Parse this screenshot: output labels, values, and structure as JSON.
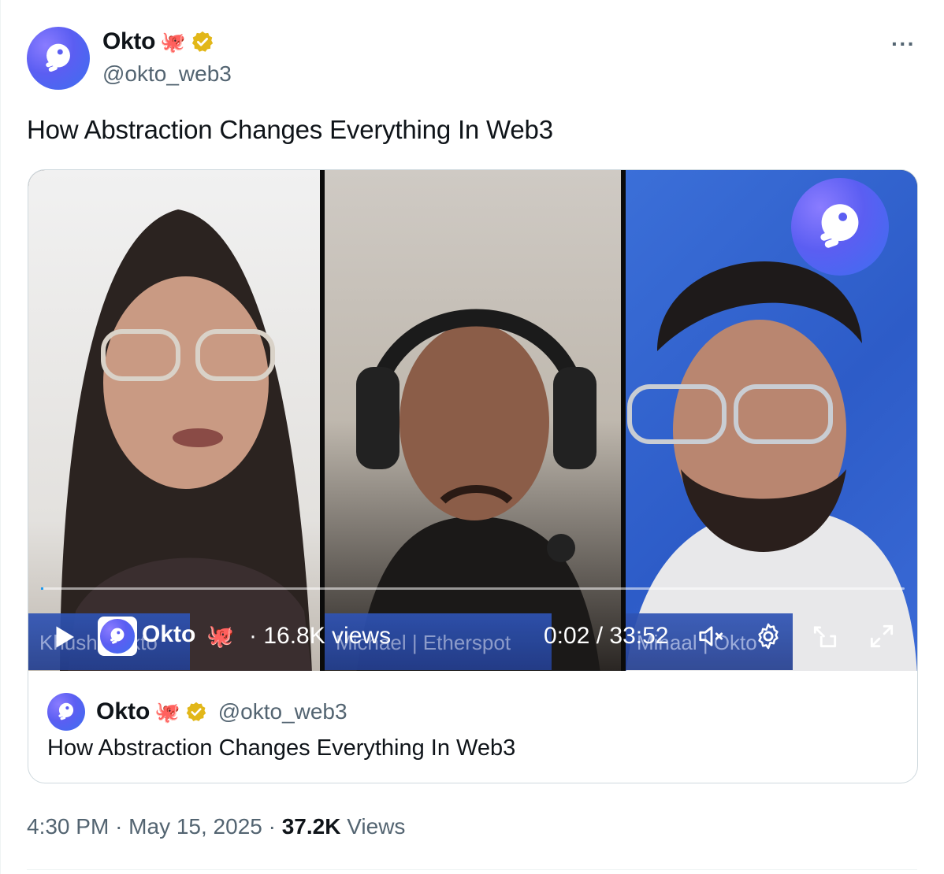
{
  "author": {
    "display_name": "Okto",
    "emoji": "🐙",
    "handle": "@okto_web3"
  },
  "more_label": "···",
  "tweet_text": "How Abstraction Changes Everything In Web3",
  "video": {
    "name_bars": [
      "Khush | Okto",
      "Michael | Etherspot",
      "Minaal | Okto"
    ],
    "progress": 0.001,
    "author_name": "Okto",
    "author_emoji": "🐙",
    "views": "· 16.8K views",
    "time": "0:02 / 33:52"
  },
  "quoted": {
    "display_name": "Okto",
    "emoji": "🐙",
    "handle": "@okto_web3",
    "text": "How Abstraction Changes Everything In Web3"
  },
  "meta": {
    "time": "4:30 PM",
    "date": "May 15, 2025",
    "views_count": "37.2K",
    "views_label": "Views"
  },
  "colors": {
    "brand_purple": "#5b5ef2",
    "verified_gold": "#e2b719",
    "accent_blue": "#1d9bf0"
  }
}
